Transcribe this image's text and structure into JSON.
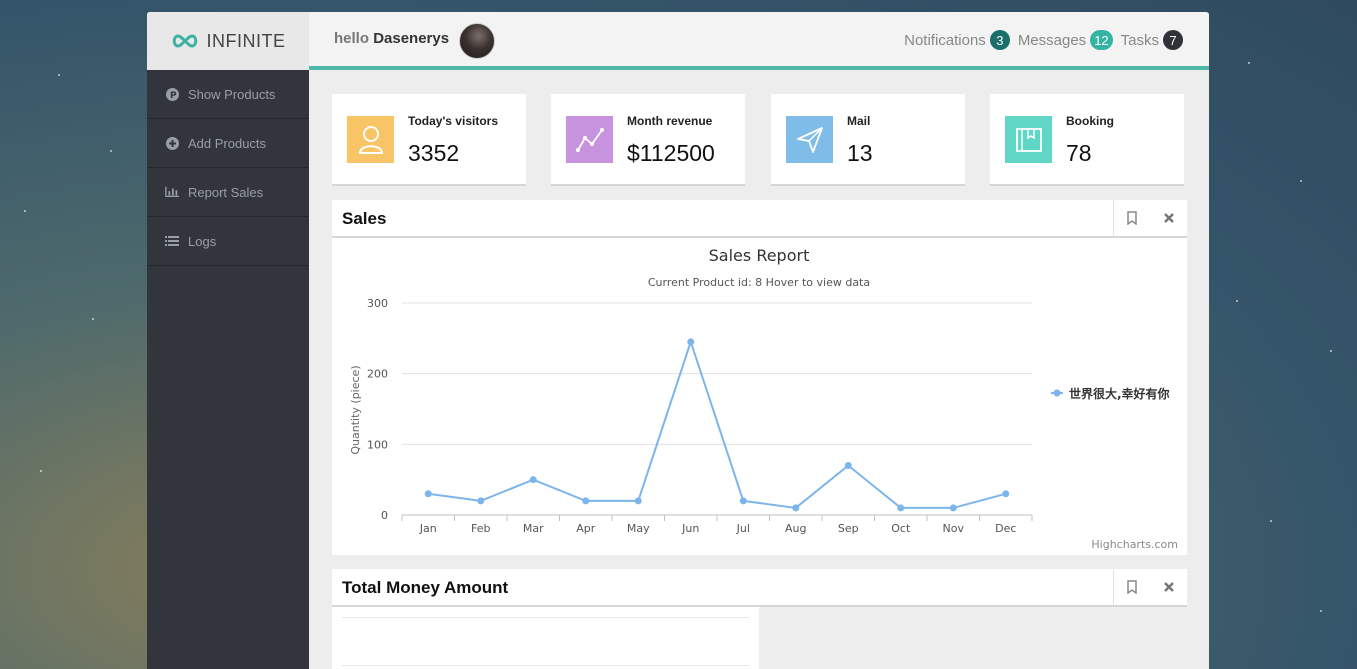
{
  "brand": {
    "name": "INFINITE"
  },
  "header": {
    "greeting": "hello",
    "username": "Dasenerys",
    "nav": [
      {
        "label": "Notifications",
        "count": "3",
        "color": "#1a6f6a"
      },
      {
        "label": "Messages",
        "count": "12",
        "color": "#35b3a3"
      },
      {
        "label": "Tasks",
        "count": "7",
        "color": "#2f3238"
      }
    ]
  },
  "sidebar": {
    "items": [
      {
        "label": "Show Products",
        "icon": "p-circle-icon"
      },
      {
        "label": "Add Products",
        "icon": "plus-circle-icon"
      },
      {
        "label": "Report Sales",
        "icon": "bar-chart-icon"
      },
      {
        "label": "Logs",
        "icon": "list-icon"
      }
    ]
  },
  "stats": [
    {
      "label": "Today's visitors",
      "value": "3352",
      "color": "#f9c466",
      "icon": "user-icon"
    },
    {
      "label": "Month revenue",
      "value": "$112500",
      "color": "#c893de",
      "icon": "trend-icon"
    },
    {
      "label": "Mail",
      "value": "13",
      "color": "#7fbde8",
      "icon": "paper-plane-icon"
    },
    {
      "label": "Booking",
      "value": "78",
      "color": "#5fd6c6",
      "icon": "book-icon"
    }
  ],
  "panels": {
    "sales": {
      "title": "Sales"
    },
    "total": {
      "title": "Total Money Amount"
    }
  },
  "chart_data": {
    "type": "line",
    "title": "Sales Report",
    "subtitle": "Current Product id: 8 Hover to view data",
    "ylabel": "Quantity (piece)",
    "xlabel": "",
    "ylim": [
      0,
      300
    ],
    "yticks": [
      0,
      100,
      200,
      300
    ],
    "categories": [
      "Jan",
      "Feb",
      "Mar",
      "Apr",
      "May",
      "Jun",
      "Jul",
      "Aug",
      "Sep",
      "Oct",
      "Nov",
      "Dec"
    ],
    "series": [
      {
        "name": "世界很大,幸好有你",
        "color": "#7cb5ec",
        "values": [
          30,
          20,
          50,
          20,
          20,
          245,
          20,
          10,
          70,
          10,
          10,
          30
        ]
      }
    ],
    "legend": "right",
    "credits": "Highcharts.com",
    "grid": true
  }
}
